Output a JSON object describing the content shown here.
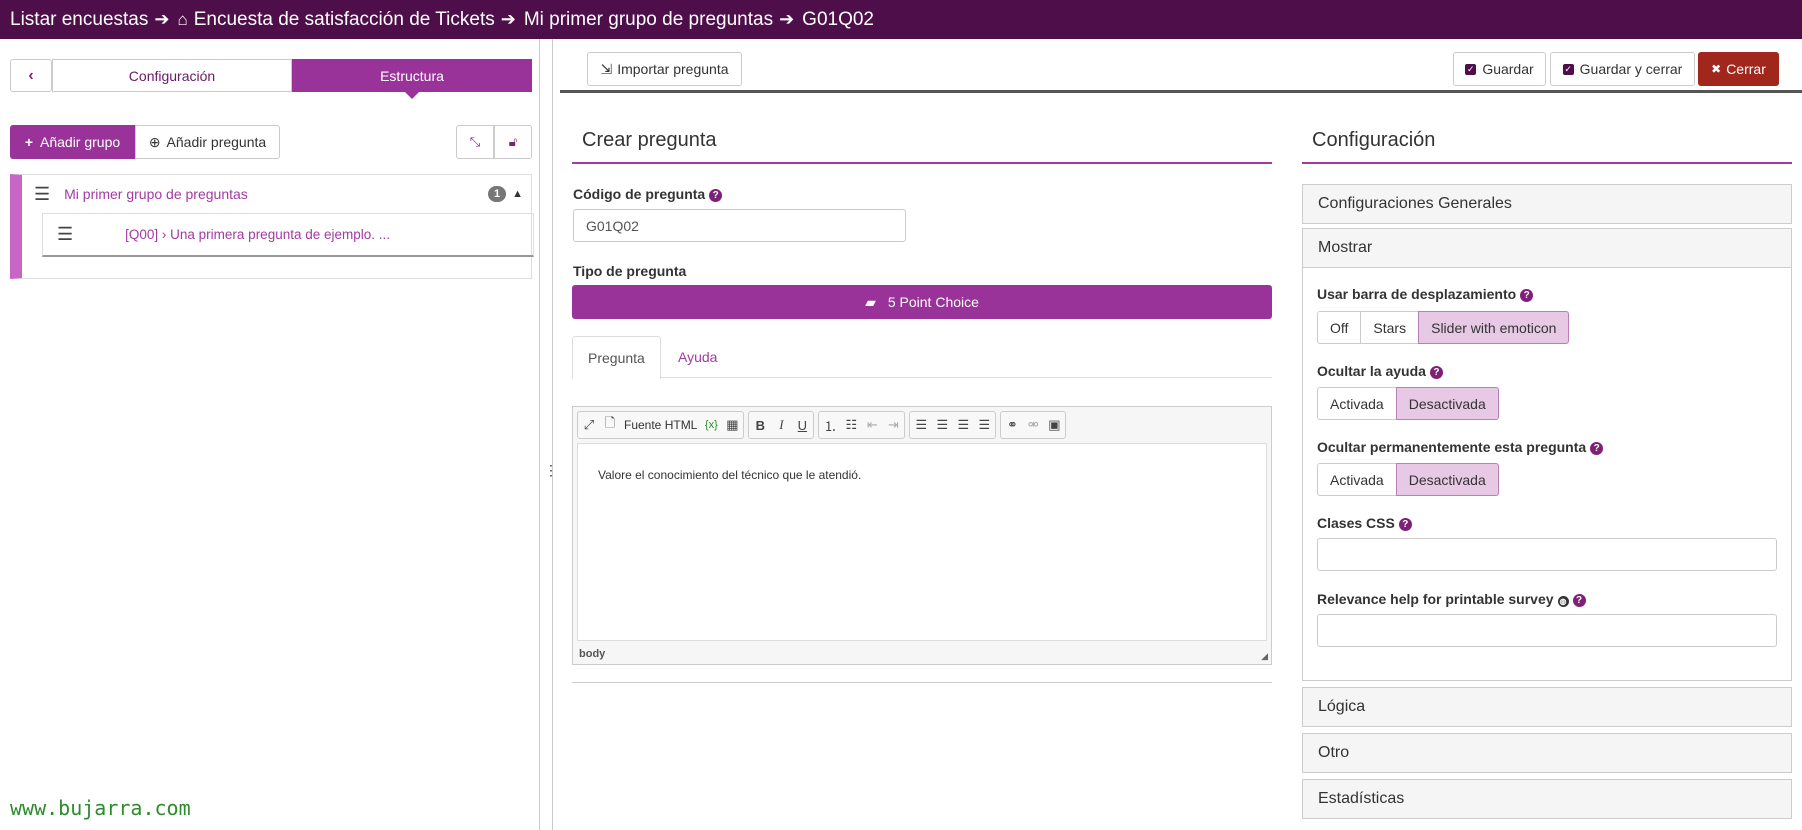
{
  "breadcrumb": {
    "items": [
      "Listar encuestas",
      "Encuesta de satisfacción de Tickets",
      "Mi primer grupo de preguntas",
      "G01Q02"
    ]
  },
  "left": {
    "tabs": [
      "Configuración",
      "Estructura"
    ],
    "add_group": "Añadir grupo",
    "add_question": "Añadir pregunta",
    "group_name": "Mi primer grupo de preguntas",
    "group_count": "1",
    "question_text": "[Q00] › Una primera pregunta de ejemplo. ..."
  },
  "watermark": "www.bujarra.com",
  "toolbar": {
    "import": "Importar pregunta",
    "save": "Guardar",
    "save_close": "Guardar y cerrar",
    "close": "Cerrar"
  },
  "create": {
    "title": "Crear pregunta",
    "code_label": "Código de pregunta",
    "code_value": "G01Q02",
    "type_label": "Tipo de pregunta",
    "type_value": "5 Point Choice",
    "tabs": [
      "Pregunta",
      "Ayuda"
    ],
    "editor_source": "Fuente HTML",
    "editor_text": "Valore el conocimiento del técnico que le atendió.",
    "editor_path": "body"
  },
  "config": {
    "title": "Configuración",
    "sections": [
      "Configuraciones Generales",
      "Mostrar",
      "Lógica",
      "Otro",
      "Estadísticas"
    ],
    "slider_label": "Usar barra de desplazamiento",
    "slider_options": [
      "Off",
      "Stars",
      "Slider with emoticon"
    ],
    "hide_help_label": "Ocultar la ayuda",
    "hide_always_label": "Ocultar permanentemente esta pregunta",
    "toggle_options": [
      "Activada",
      "Desactivada"
    ],
    "css_label": "Clases CSS",
    "relevance_label": "Relevance help for printable survey"
  },
  "colors": {
    "brand": "#4e0e4a",
    "accent": "#993399",
    "danger": "#a1261c"
  }
}
